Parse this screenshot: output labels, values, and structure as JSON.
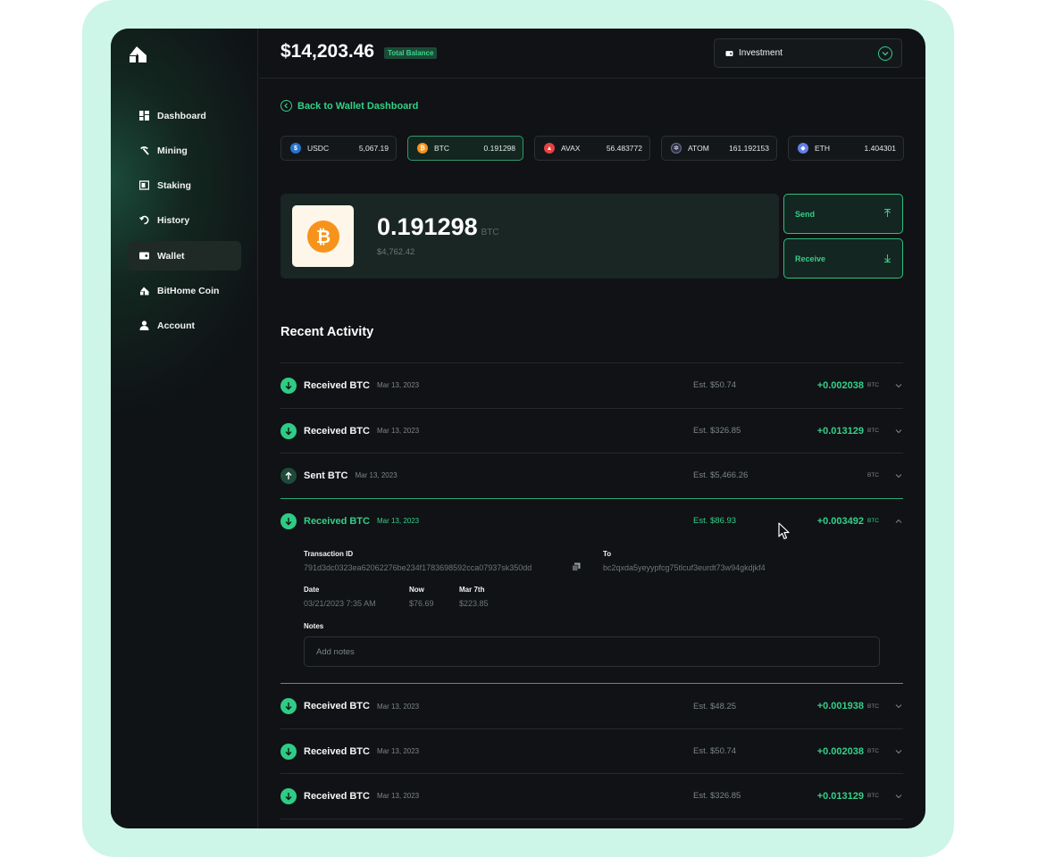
{
  "sidebar": {
    "items": [
      {
        "label": "Dashboard",
        "icon": "grid-icon"
      },
      {
        "label": "Mining",
        "icon": "pickaxe-icon"
      },
      {
        "label": "Staking",
        "icon": "staking-icon"
      },
      {
        "label": "History",
        "icon": "history-icon"
      },
      {
        "label": "Wallet",
        "icon": "wallet-icon",
        "active": true
      },
      {
        "label": "BitHome Coin",
        "icon": "bithome-icon"
      },
      {
        "label": "Account",
        "icon": "user-icon"
      }
    ]
  },
  "header": {
    "balance": "$14,203.46",
    "balance_badge": "Total Balance",
    "wallet_select": "Investment"
  },
  "back_link": "Back to Wallet Dashboard",
  "tokens": [
    {
      "symbol": "USDC",
      "value": "5,067.19",
      "color": "#2775ca"
    },
    {
      "symbol": "BTC",
      "value": "0.191298",
      "color": "#f7931a",
      "active": true
    },
    {
      "symbol": "AVAX",
      "value": "56.483772",
      "color": "#e84142"
    },
    {
      "symbol": "ATOM",
      "value": "161.192153",
      "color": "#2e3148"
    },
    {
      "symbol": "ETH",
      "value": "1.404301",
      "color": "#627eea"
    }
  ],
  "coin": {
    "amount": "0.191298",
    "unit": "BTC",
    "usd": "$4,762.42",
    "send_label": "Send",
    "receive_label": "Receive"
  },
  "activity": {
    "title": "Recent Activity",
    "rows": [
      {
        "title": "Received BTC",
        "date": "Mar 13, 2023",
        "est": "Est. $50.74",
        "amount": "+0.002038",
        "unit": "BTC",
        "type": "received"
      },
      {
        "title": "Received BTC",
        "date": "Mar 13, 2023",
        "est": "Est. $326.85",
        "amount": "+0.013129",
        "unit": "BTC",
        "type": "received"
      },
      {
        "title": "Sent BTC",
        "date": "Mar 13, 2023",
        "est": "Est. $5,466.26",
        "amount": "",
        "unit": "BTC",
        "type": "sent"
      },
      {
        "title": "Received BTC",
        "date": "Mar 13, 2023",
        "est": "Est. $86.93",
        "amount": "+0.003492",
        "unit": "BTC",
        "type": "received",
        "expanded": true
      },
      {
        "title": "Received BTC",
        "date": "Mar 13, 2023",
        "est": "Est. $48.25",
        "amount": "+0.001938",
        "unit": "BTC",
        "type": "received"
      },
      {
        "title": "Received BTC",
        "date": "Mar 13, 2023",
        "est": "Est. $50.74",
        "amount": "+0.002038",
        "unit": "BTC",
        "type": "received"
      },
      {
        "title": "Received BTC",
        "date": "Mar 13, 2023",
        "est": "Est. $326.85",
        "amount": "+0.013129",
        "unit": "BTC",
        "type": "received"
      }
    ],
    "details": {
      "txid_label": "Transaction ID",
      "txid": "791d3dc0323ea62062276be234f1783698592cca07937sk350dd",
      "to_label": "To",
      "to": "bc2qxda5yeyypfcg75tlcuf3eurdt73w94gkdjkf4",
      "date_label": "Date",
      "date": "03/21/2023 7:35 AM",
      "now_label": "Now",
      "now": "$76.69",
      "mar_label": "Mar 7th",
      "mar": "$223.85",
      "notes_label": "Notes",
      "notes_placeholder": "Add notes"
    }
  }
}
